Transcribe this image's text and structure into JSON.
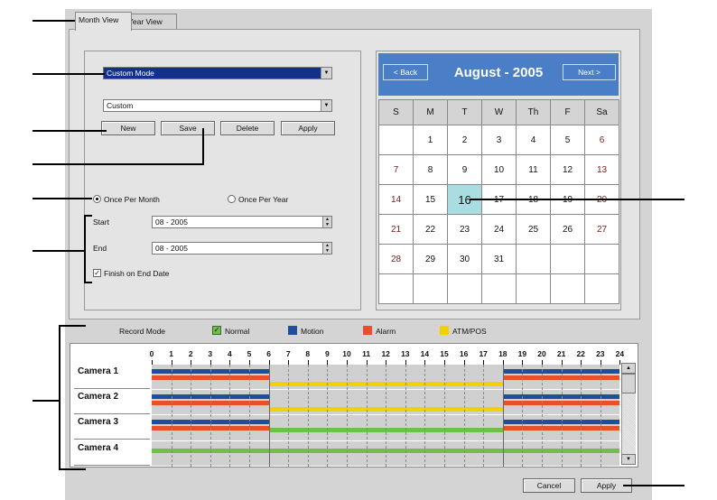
{
  "tabs": [
    {
      "label": "Month View",
      "active": true
    },
    {
      "label": "Year View",
      "active": false
    }
  ],
  "mode_combo": {
    "value": "Custom Mode"
  },
  "preset_combo": {
    "value": "Custom"
  },
  "buttons": {
    "new": "New",
    "save": "Save",
    "delete": "Delete",
    "apply": "Apply"
  },
  "repeat": {
    "once_per_month": "Once Per Month",
    "once_per_year": "Once Per Year",
    "selected": "once_per_month"
  },
  "start": {
    "label": "Start",
    "value": "08 - 2005"
  },
  "end": {
    "label": "End",
    "value": "08 - 2005"
  },
  "finish_on_end": {
    "label": "Finish on End Date",
    "checked": true,
    "mark": "✓"
  },
  "calendar": {
    "back": "< Back",
    "next": "Next >",
    "title": "August - 2005",
    "day_headers": [
      "S",
      "M",
      "T",
      "W",
      "Th",
      "F",
      "Sa"
    ],
    "weeks": [
      [
        "",
        "1",
        "2",
        "3",
        "4",
        "5",
        "6"
      ],
      [
        "7",
        "8",
        "9",
        "10",
        "11",
        "12",
        "13"
      ],
      [
        "14",
        "15",
        "16",
        "17",
        "18",
        "19",
        "20"
      ],
      [
        "21",
        "22",
        "23",
        "24",
        "25",
        "26",
        "27"
      ],
      [
        "28",
        "29",
        "30",
        "31",
        "",
        "",
        ""
      ],
      [
        "",
        "",
        "",
        "",
        "",
        "",
        ""
      ]
    ],
    "today": "16"
  },
  "legend": {
    "title": "Record Mode",
    "items": [
      {
        "label": "Normal",
        "color": "#6ec04a",
        "checked": true
      },
      {
        "label": "Motion",
        "color": "#1f4e9e"
      },
      {
        "label": "Alarm",
        "color": "#e8502a"
      },
      {
        "label": "ATM/POS",
        "color": "#f5d000"
      }
    ]
  },
  "schedule": {
    "hours": [
      "0",
      "1",
      "2",
      "3",
      "4",
      "5",
      "6",
      "7",
      "8",
      "9",
      "10",
      "11",
      "12",
      "13",
      "14",
      "15",
      "16",
      "17",
      "18",
      "19",
      "20",
      "21",
      "22",
      "23",
      "24"
    ],
    "cameras": [
      {
        "name": "Camera 1",
        "segments": [
          {
            "mode": "motion",
            "start": 0,
            "end": 6
          },
          {
            "mode": "alarm",
            "start": 0,
            "end": 6
          },
          {
            "mode": "atm",
            "start": 6,
            "end": 18
          },
          {
            "mode": "motion",
            "start": 18,
            "end": 24
          },
          {
            "mode": "alarm",
            "start": 18,
            "end": 24
          }
        ]
      },
      {
        "name": "Camera 2",
        "segments": [
          {
            "mode": "motion",
            "start": 0,
            "end": 6
          },
          {
            "mode": "alarm",
            "start": 0,
            "end": 6
          },
          {
            "mode": "atm",
            "start": 6,
            "end": 18
          },
          {
            "mode": "motion",
            "start": 18,
            "end": 24
          },
          {
            "mode": "alarm",
            "start": 18,
            "end": 24
          }
        ]
      },
      {
        "name": "Camera 3",
        "segments": [
          {
            "mode": "motion",
            "start": 0,
            "end": 6
          },
          {
            "mode": "alarm",
            "start": 0,
            "end": 6
          },
          {
            "mode": "normal",
            "start": 6,
            "end": 18
          },
          {
            "mode": "motion",
            "start": 18,
            "end": 24
          },
          {
            "mode": "alarm",
            "start": 18,
            "end": 24
          }
        ]
      },
      {
        "name": "Camera 4",
        "segments": [
          {
            "mode": "normal",
            "start": 0,
            "end": 24
          }
        ]
      }
    ]
  },
  "footer": {
    "cancel": "Cancel",
    "apply": "Apply"
  }
}
